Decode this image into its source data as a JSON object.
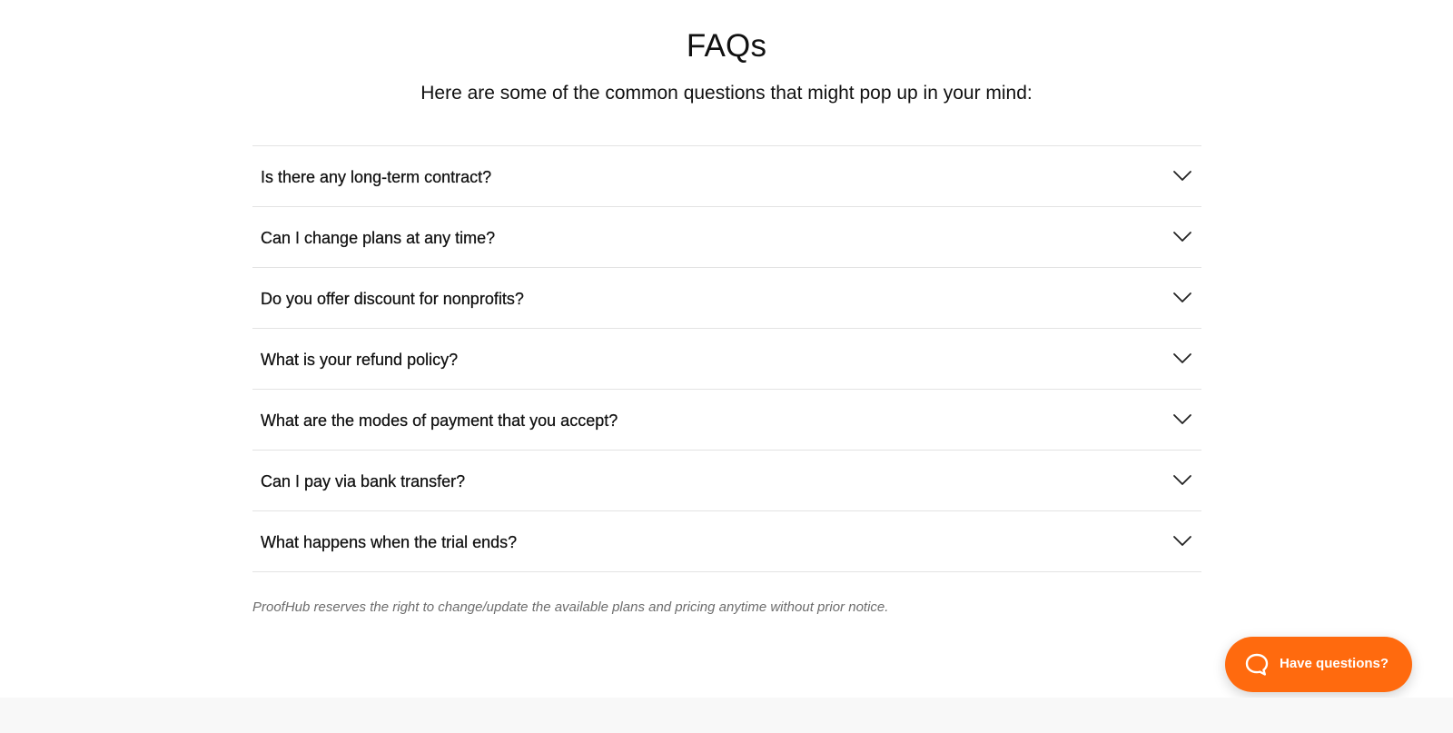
{
  "faq": {
    "title": "FAQs",
    "subtitle": "Here are some of the common questions that might pop up in your mind:",
    "items": [
      {
        "question": "Is there any long-term contract?",
        "icon": "chevron-down-icon"
      },
      {
        "question": "Can I change plans at any time?",
        "icon": "chevron-down-icon"
      },
      {
        "question": "Do you offer discount for nonprofits?",
        "icon": "chevron-down-icon"
      },
      {
        "question": "What is your refund policy?",
        "icon": "chevron-down-icon"
      },
      {
        "question": "What are the modes of payment that you accept?",
        "icon": "chevron-down-icon"
      },
      {
        "question": "Can I pay via bank transfer?",
        "icon": "chevron-down-icon"
      },
      {
        "question": "What happens when the trial ends?",
        "icon": "chevron-down-icon"
      }
    ],
    "disclaimer": "ProofHub reserves the right to change/update the available plans and pricing anytime without prior notice."
  },
  "help_widget": {
    "label": "Have questions?",
    "icon": "chat-bubble-icon",
    "background": "#ff6a0e"
  },
  "colors": {
    "accent": "#ff6a0e",
    "divider": "#e3e3e3",
    "muted_text": "#6d6d6d",
    "footer_background": "#f8f8f8"
  }
}
